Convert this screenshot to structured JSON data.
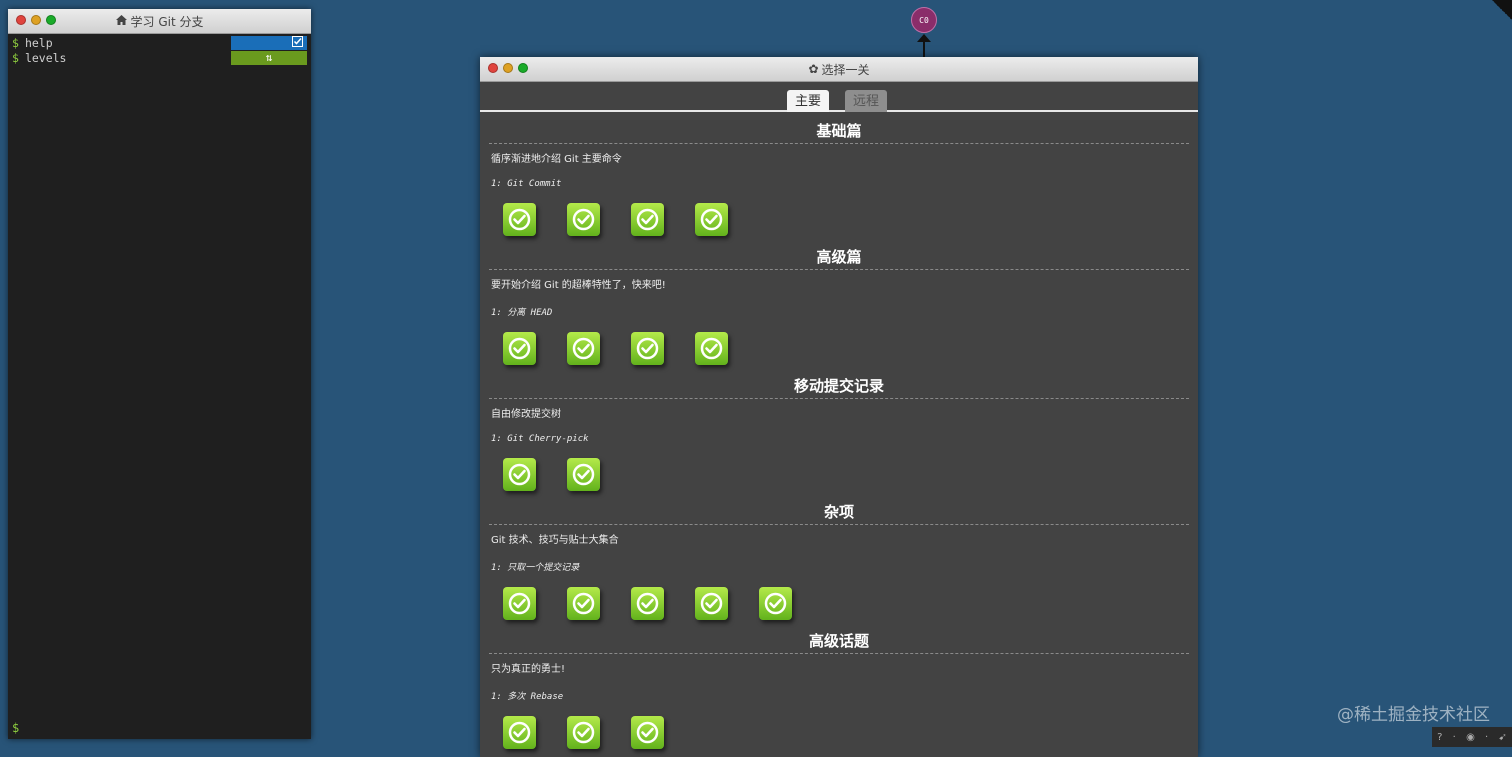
{
  "terminal": {
    "title": "学习 Git 分支",
    "home_icon": "home-icon",
    "prompt": "$",
    "lines": [
      {
        "text": "help",
        "badge_icon": "checkbox-icon",
        "badge_color": "#1a6eb8"
      },
      {
        "text": "levels",
        "badge_icon": "swap-icon",
        "badge_color": "#6a9a1e"
      }
    ]
  },
  "graph": {
    "node_label": "C0",
    "node_color": "#8a2d6a"
  },
  "dialog": {
    "title": "选择一关",
    "gear_icon": "gear-icon",
    "tabs": [
      {
        "label": "主要",
        "active": true
      },
      {
        "label": "远程",
        "active": false
      }
    ],
    "sequences": [
      {
        "title": "基础篇",
        "description": "循序渐进地介绍 Git 主要命令",
        "first_level": "1: Git Commit",
        "levels_solved": 4
      },
      {
        "title": "高级篇",
        "description": "要开始介绍 Git 的超棒特性了，快来吧!",
        "first_level": "1: 分离 HEAD",
        "levels_solved": 4
      },
      {
        "title": "移动提交记录",
        "description": "自由修改提交树",
        "first_level": "1: Git Cherry-pick",
        "levels_solved": 2
      },
      {
        "title": "杂项",
        "description": "Git 技术、技巧与贴士大集合",
        "first_level": "1: 只取一个提交记录",
        "levels_solved": 5
      },
      {
        "title": "高级话题",
        "description": "只为真正的勇士!",
        "first_level": "1: 多次 Rebase",
        "levels_solved": 3
      }
    ]
  },
  "watermark": "@稀土掘金技术社区",
  "colors": {
    "background": "#285478",
    "level_green": "#8dd033"
  }
}
